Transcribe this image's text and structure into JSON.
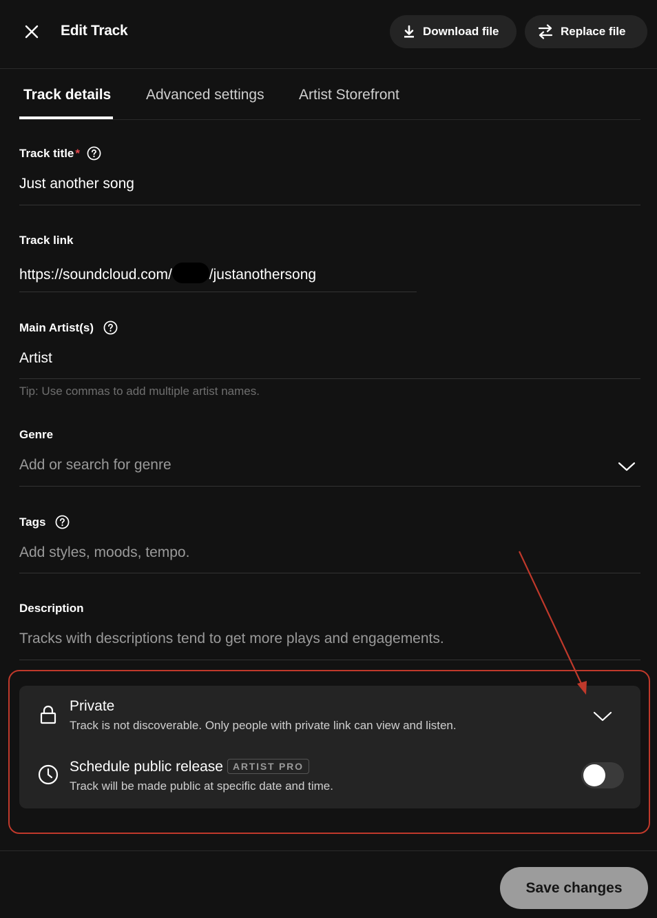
{
  "header": {
    "title": "Edit Track",
    "download_label": "Download file",
    "replace_label": "Replace file"
  },
  "tabs": [
    {
      "label": "Track details",
      "active": true
    },
    {
      "label": "Advanced settings",
      "active": false
    },
    {
      "label": "Artist Storefront",
      "active": false
    }
  ],
  "form": {
    "track_title": {
      "label": "Track title",
      "required_mark": "*",
      "value": "Just another song"
    },
    "track_link": {
      "label": "Track link",
      "prefix": "https://soundcloud.com/",
      "suffix": "/justanothersong"
    },
    "main_artists": {
      "label": "Main Artist(s)",
      "value": "Artist",
      "tip": "Tip: Use commas to add multiple artist names."
    },
    "genre": {
      "label": "Genre",
      "placeholder": "Add or search for genre"
    },
    "tags": {
      "label": "Tags",
      "placeholder": "Add styles, moods, tempo."
    },
    "description": {
      "label": "Description",
      "placeholder": "Tracks with descriptions tend to get more plays and engagements."
    }
  },
  "privacy": {
    "visibility_title": "Private",
    "visibility_desc": "Track is not discoverable. Only people with private link can view and listen.",
    "schedule_title": "Schedule public release",
    "schedule_badge": "ARTIST PRO",
    "schedule_desc": "Track will be made public at specific date and time.",
    "schedule_enabled": false
  },
  "footer": {
    "save_label": "Save changes"
  },
  "colors": {
    "background": "#121212",
    "card": "#242424",
    "annotation": "#c0392b",
    "required": "#e5484d",
    "save_button": "#9c9c9c"
  }
}
